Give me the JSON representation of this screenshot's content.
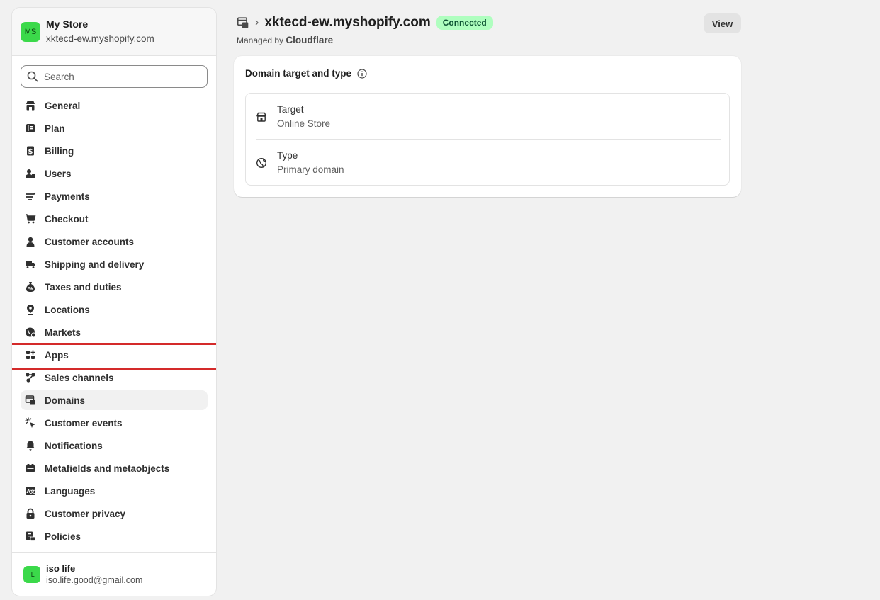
{
  "store": {
    "avatar_initials": "MS",
    "name": "My Store",
    "domain": "xktecd-ew.myshopify.com"
  },
  "search": {
    "placeholder": "Search"
  },
  "nav": {
    "items": [
      {
        "label": "General",
        "icon": "store-icon"
      },
      {
        "label": "Plan",
        "icon": "plan-icon"
      },
      {
        "label": "Billing",
        "icon": "billing-icon"
      },
      {
        "label": "Users",
        "icon": "users-icon"
      },
      {
        "label": "Payments",
        "icon": "payments-icon"
      },
      {
        "label": "Checkout",
        "icon": "cart-icon"
      },
      {
        "label": "Customer accounts",
        "icon": "person-icon"
      },
      {
        "label": "Shipping and delivery",
        "icon": "truck-icon"
      },
      {
        "label": "Taxes and duties",
        "icon": "tax-icon"
      },
      {
        "label": "Locations",
        "icon": "location-icon"
      },
      {
        "label": "Markets",
        "icon": "globe-icon"
      },
      {
        "label": "Apps",
        "icon": "apps-icon"
      },
      {
        "label": "Sales channels",
        "icon": "sales-channels-icon"
      },
      {
        "label": "Domains",
        "icon": "domains-icon"
      },
      {
        "label": "Customer events",
        "icon": "cursor-click-icon"
      },
      {
        "label": "Notifications",
        "icon": "bell-icon"
      },
      {
        "label": "Metafields and metaobjects",
        "icon": "metafields-icon"
      },
      {
        "label": "Languages",
        "icon": "language-icon"
      },
      {
        "label": "Customer privacy",
        "icon": "lock-icon"
      },
      {
        "label": "Policies",
        "icon": "policies-icon"
      }
    ],
    "active": "Domains",
    "highlighted": "Apps"
  },
  "user": {
    "avatar_initials": "IL",
    "name": "iso life",
    "email": "iso.life.good@gmail.com"
  },
  "header": {
    "title": "xktecd-ew.myshopify.com",
    "status_badge": "Connected",
    "managed_by_prefix": "Managed by",
    "managed_by": "Cloudflare",
    "view_button": "View"
  },
  "card": {
    "title": "Domain target and type",
    "target_label": "Target",
    "target_value": "Online Store",
    "type_label": "Type",
    "type_value": "Primary domain"
  },
  "colors": {
    "accent_green": "#3bd94a",
    "badge_bg": "#affebf",
    "highlight_red": "#d42a2a"
  }
}
